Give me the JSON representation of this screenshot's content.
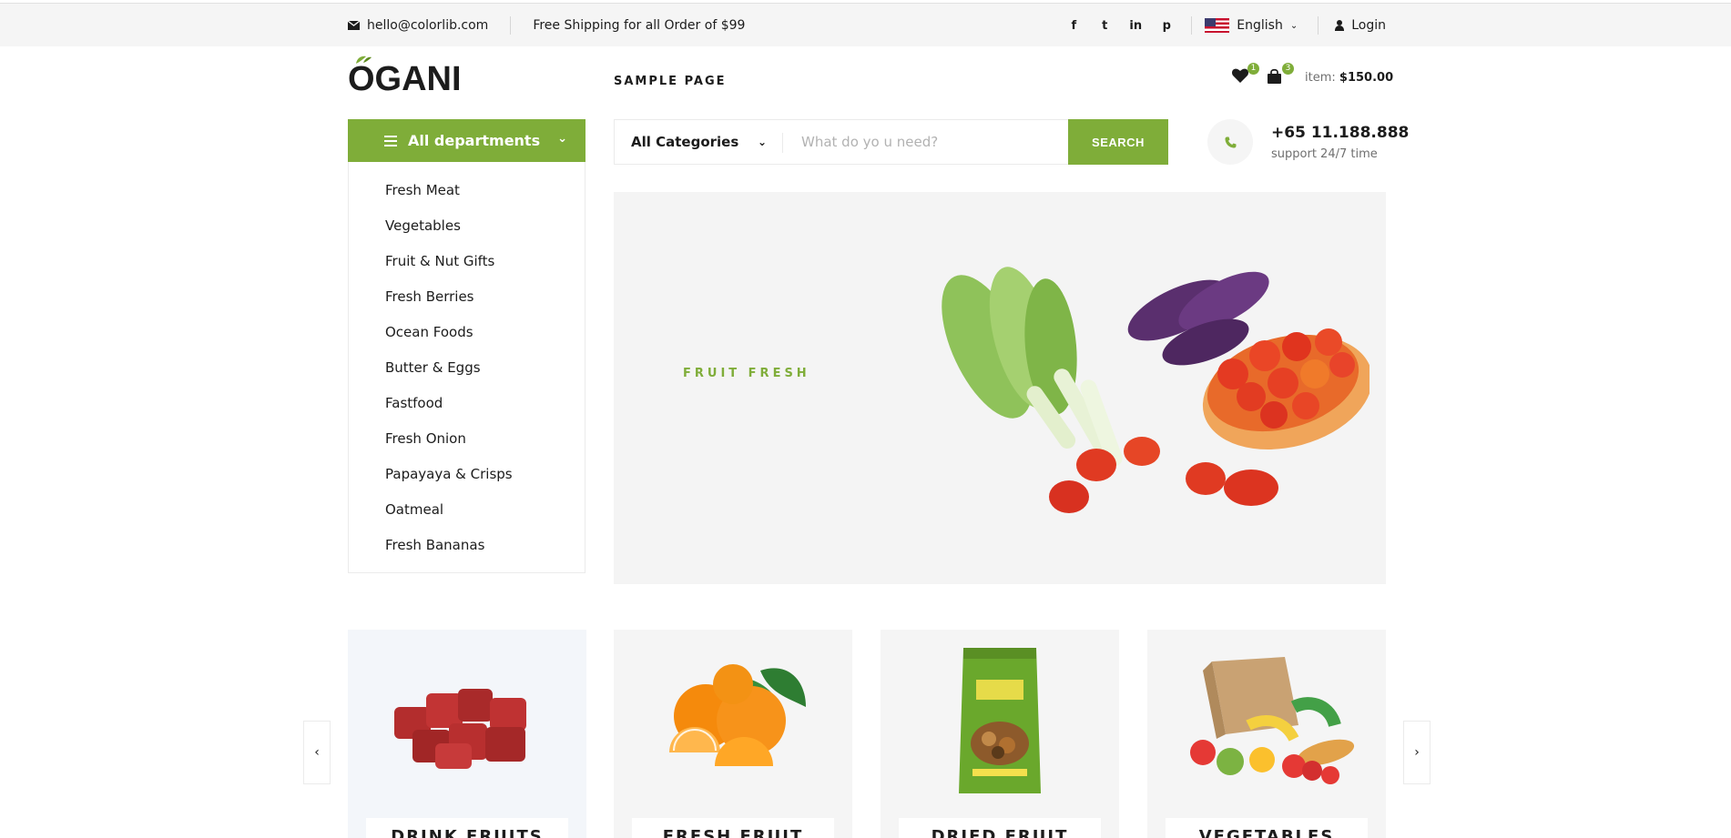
{
  "topbar": {
    "email": "hello@colorlib.com",
    "shipping": "Free Shipping for all Order of $99",
    "social": [
      "f",
      "t",
      "in",
      "p"
    ],
    "language": "English",
    "login": "Login"
  },
  "header": {
    "logo": "OGANI",
    "nav_item": "SAMPLE PAGE",
    "wishlist_count": "1",
    "cart_count": "3",
    "cart_label": "item:",
    "cart_total": "$150.00"
  },
  "departments": {
    "title": "All departments",
    "items": [
      "Fresh Meat",
      "Vegetables",
      "Fruit & Nut Gifts",
      "Fresh Berries",
      "Ocean Foods",
      "Butter & Eggs",
      "Fastfood",
      "Fresh Onion",
      "Papayaya & Crisps",
      "Oatmeal",
      "Fresh Bananas"
    ]
  },
  "search": {
    "category": "All Categories",
    "placeholder": "What do yo u need?",
    "button": "SEARCH"
  },
  "contact": {
    "phone": "+65 11.188.888",
    "support": "support 24/7 time"
  },
  "hero": {
    "tag": "FRUIT FRESH"
  },
  "categories": [
    "DRINK FRUITS",
    "FRESH FRUIT",
    "DRIED FRUIT",
    "VEGETABLES"
  ],
  "colors": {
    "accent": "#7fad39",
    "text": "#1c1c1c",
    "muted": "#6f6f6f"
  }
}
